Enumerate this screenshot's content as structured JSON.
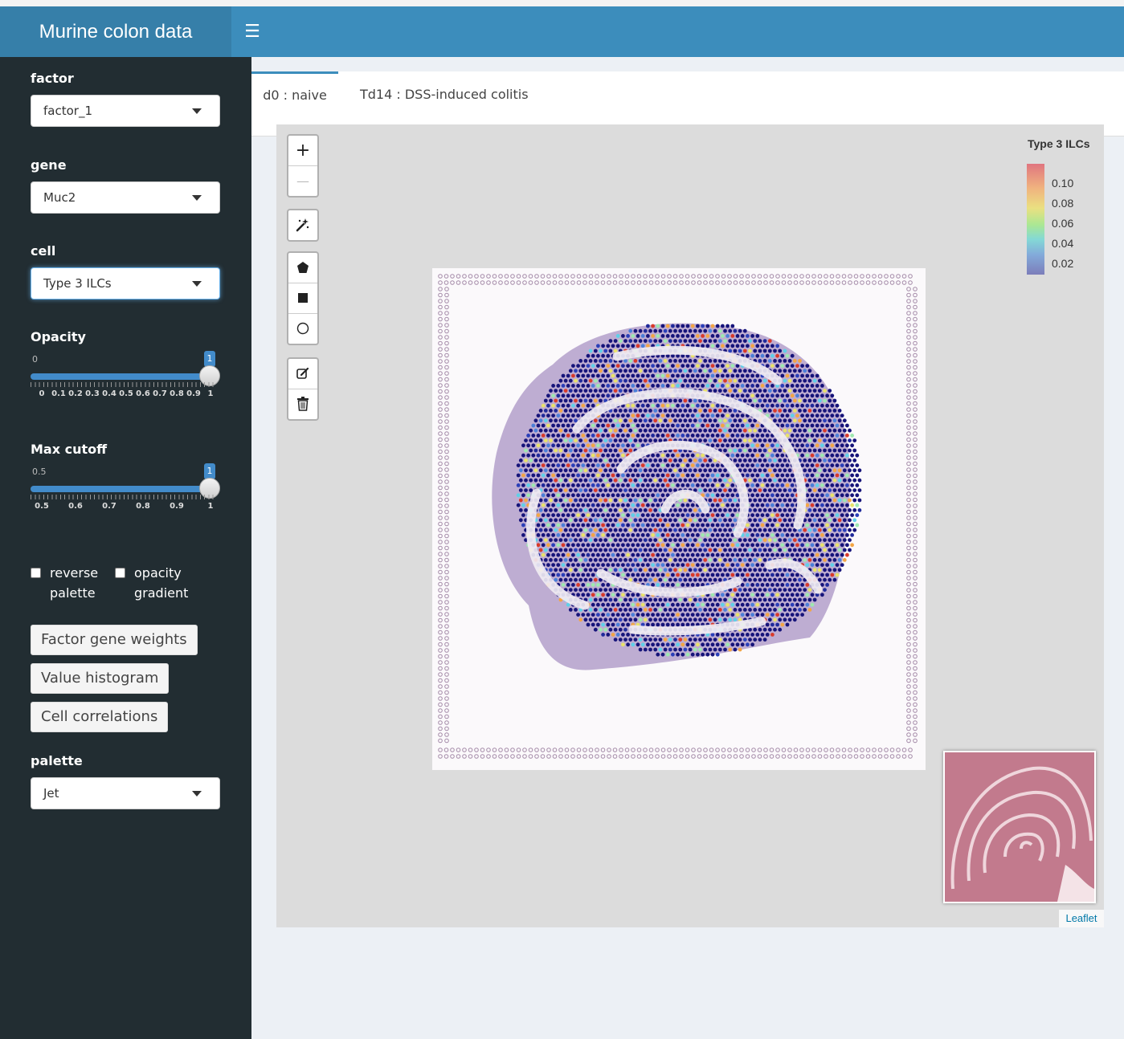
{
  "app": {
    "title": "Murine colon data"
  },
  "sidebar": {
    "factor": {
      "label": "factor",
      "value": "factor_1"
    },
    "gene": {
      "label": "gene",
      "value": "Muc2"
    },
    "cell": {
      "label": "cell",
      "value": "Type 3 ILCs"
    },
    "opacity": {
      "label": "Opacity",
      "min": "0",
      "value": "1",
      "ticks": [
        "0",
        "0.1",
        "0.2",
        "0.3",
        "0.4",
        "0.5",
        "0.6",
        "0.7",
        "0.8",
        "0.9",
        "1"
      ]
    },
    "max_cutoff": {
      "label": "Max cutoff",
      "min": "0.5",
      "value": "1",
      "ticks": [
        "0.5",
        "0.6",
        "0.7",
        "0.8",
        "0.9",
        "1"
      ]
    },
    "reverse_palette": {
      "label_1": "reverse",
      "label_2": "palette",
      "checked": false
    },
    "opacity_gradient": {
      "label_1": "opacity",
      "label_2": "gradient",
      "checked": false
    },
    "buttons": {
      "factor_gene_weights": "Factor gene weights",
      "value_histogram": "Value histogram",
      "cell_correlations": "Cell correlations"
    },
    "palette": {
      "label": "palette",
      "value": "Jet"
    }
  },
  "tabs": [
    {
      "label": "d0 : naive",
      "active": true
    },
    {
      "label": "Td14 : DSS-induced colitis",
      "active": false
    }
  ],
  "map": {
    "zoom_in": "+",
    "zoom_out": "—",
    "legend": {
      "title": "Type 3 ILCs",
      "ticks": [
        "0.10",
        "0.08",
        "0.06",
        "0.04",
        "0.02"
      ]
    },
    "attribution": "Leaflet"
  }
}
